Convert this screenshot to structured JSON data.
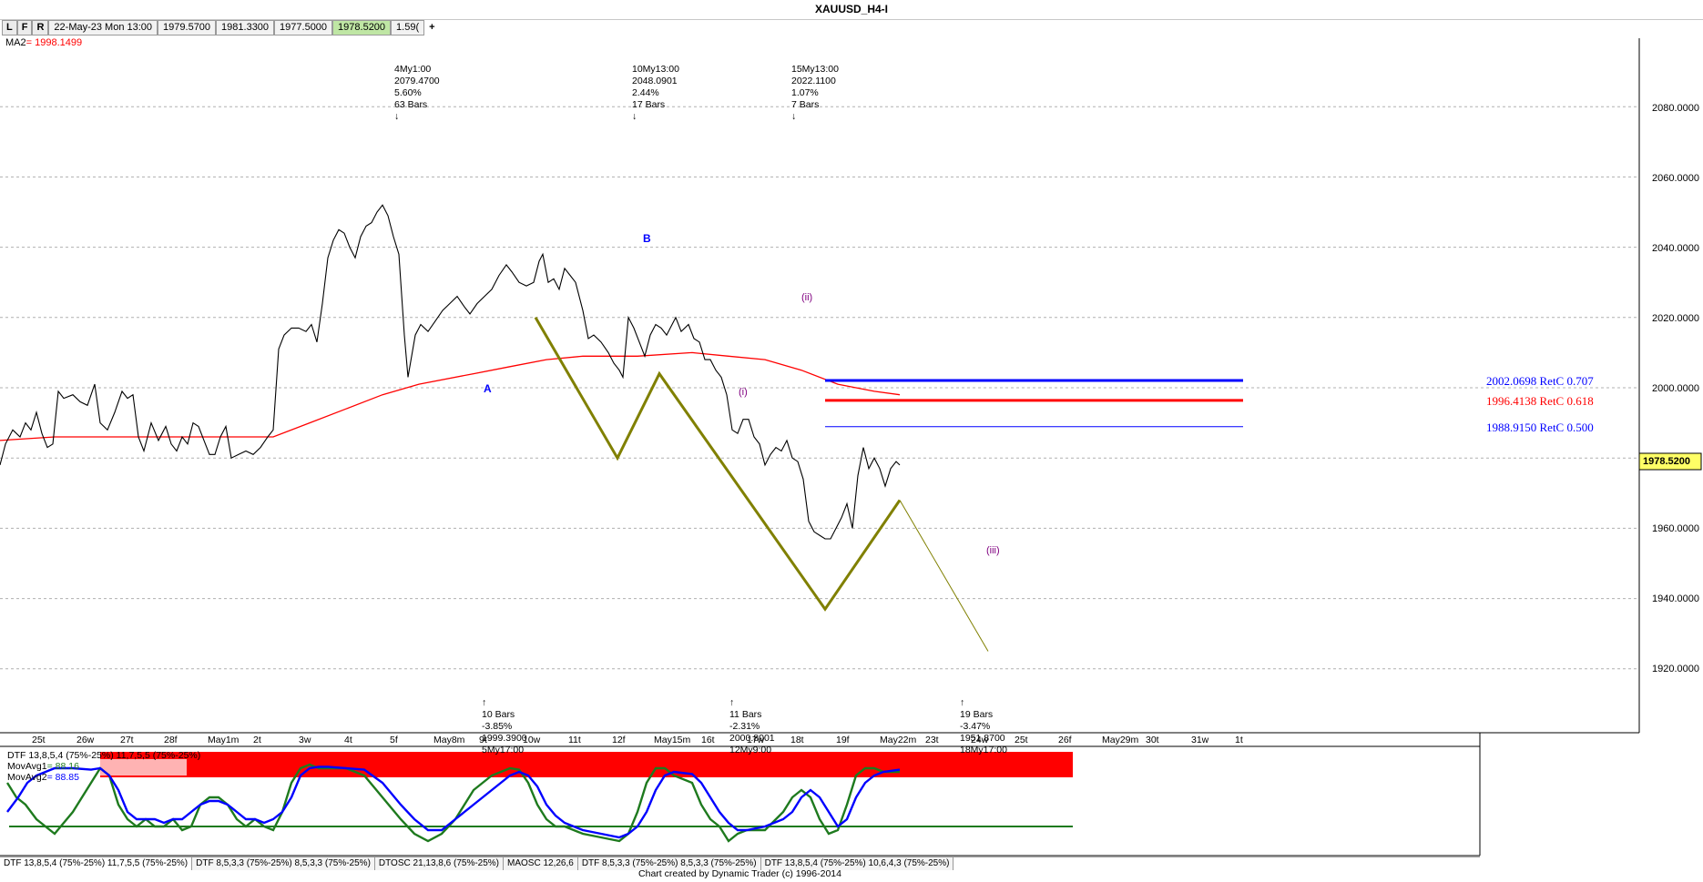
{
  "window": {
    "title": "XAUUSD_H4-I"
  },
  "toolbar": {
    "buttons": [
      "L",
      "F",
      "R"
    ],
    "quote": [
      "22-May-23 Mon 13:00",
      "1979.5700",
      "1981.3300",
      "1977.5000",
      "1978.5200",
      "1.59("
    ],
    "add_label": "+"
  },
  "ma2": {
    "label": "MA2",
    "value": "= 1998.1499",
    "color": "#ff0000"
  },
  "colors": {
    "price_line": "#000000",
    "ma_line": "#ff0000",
    "wave_pattern": "#808000",
    "ret_707": "#0000ff",
    "ret_618": "#ff0000",
    "ret_500": "#0000ff",
    "osc_fast": "#1e7a1e",
    "osc_slow": "#0000ff",
    "osc_band": "#ff0000"
  },
  "price_axis": {
    "ticks": [
      "2080.0000",
      "2060.0000",
      "2040.0000",
      "2020.0000",
      "2000.0000",
      "1960.0000",
      "1940.0000",
      "1920.0000"
    ],
    "current_price": "1978.5200"
  },
  "retracements": [
    {
      "label": "2002.0698 RetC 0.707",
      "price": 2002.0698
    },
    {
      "label": "1996.4138 RetC 0.618",
      "price": 1996.4138
    },
    {
      "label": "1988.9150 RetC 0.500",
      "price": 1988.915
    }
  ],
  "wave_labels": [
    "A",
    "B",
    "(i)",
    "(ii)",
    "(iii)"
  ],
  "top_annotations": [
    {
      "lines": [
        "4My1:00",
        "2079.4700",
        "5.60%",
        "63 Bars"
      ]
    },
    {
      "lines": [
        "10My13:00",
        "2048.0901",
        "2.44%",
        "17 Bars"
      ]
    },
    {
      "lines": [
        "15My13:00",
        "2022.1100",
        "1.07%",
        "7 Bars"
      ]
    }
  ],
  "bottom_annotations": [
    {
      "lines": [
        "10 Bars",
        "-3.85%",
        "1999.3900",
        "5My17:00"
      ]
    },
    {
      "lines": [
        "11 Bars",
        "-2.31%",
        "2000.8001",
        "12My9:00"
      ]
    },
    {
      "lines": [
        "19 Bars",
        "-3.47%",
        "1951.8700",
        "18My17:00"
      ]
    }
  ],
  "time_axis": [
    "25t",
    "26w",
    "27t",
    "28f",
    "May1m",
    "2t",
    "3w",
    "4t",
    "5f",
    "May8m",
    "9t",
    "10w",
    "11t",
    "12f",
    "May15m",
    "16t",
    "17w",
    "18t",
    "19f",
    "May22m",
    "23t",
    "24w",
    "25t",
    "26f",
    "May29m",
    "30t",
    "31w",
    "1t"
  ],
  "indicator": {
    "header": "DTF 13,8,5,4 (75%-25%)  11,7,5,5 (75%-25%)",
    "movavg1": {
      "label": "MovAvg1",
      "value": "= 88.16"
    },
    "movavg2": {
      "label": "MovAvg2",
      "value": "= 88.85"
    }
  },
  "bottom_tabs": [
    "DTF 13,8,5,4 (75%-25%) 11,7,5,5 (75%-25%)",
    "DTF 8,5,3,3 (75%-25%) 8,5,3,3 (75%-25%)",
    "DTOSC 21,13,8,6 (75%-25%)",
    "MAOSC 12,26,6",
    "DTF 8,5,3,3 (75%-25%) 8,5,3,3 (75%-25%)",
    "DTF 13,8,5,4 (75%-25%) 10,6,4,3 (75%-25%)"
  ],
  "footer": {
    "credit": "Chart created by Dynamic Trader  (c)  1996-2014"
  }
}
